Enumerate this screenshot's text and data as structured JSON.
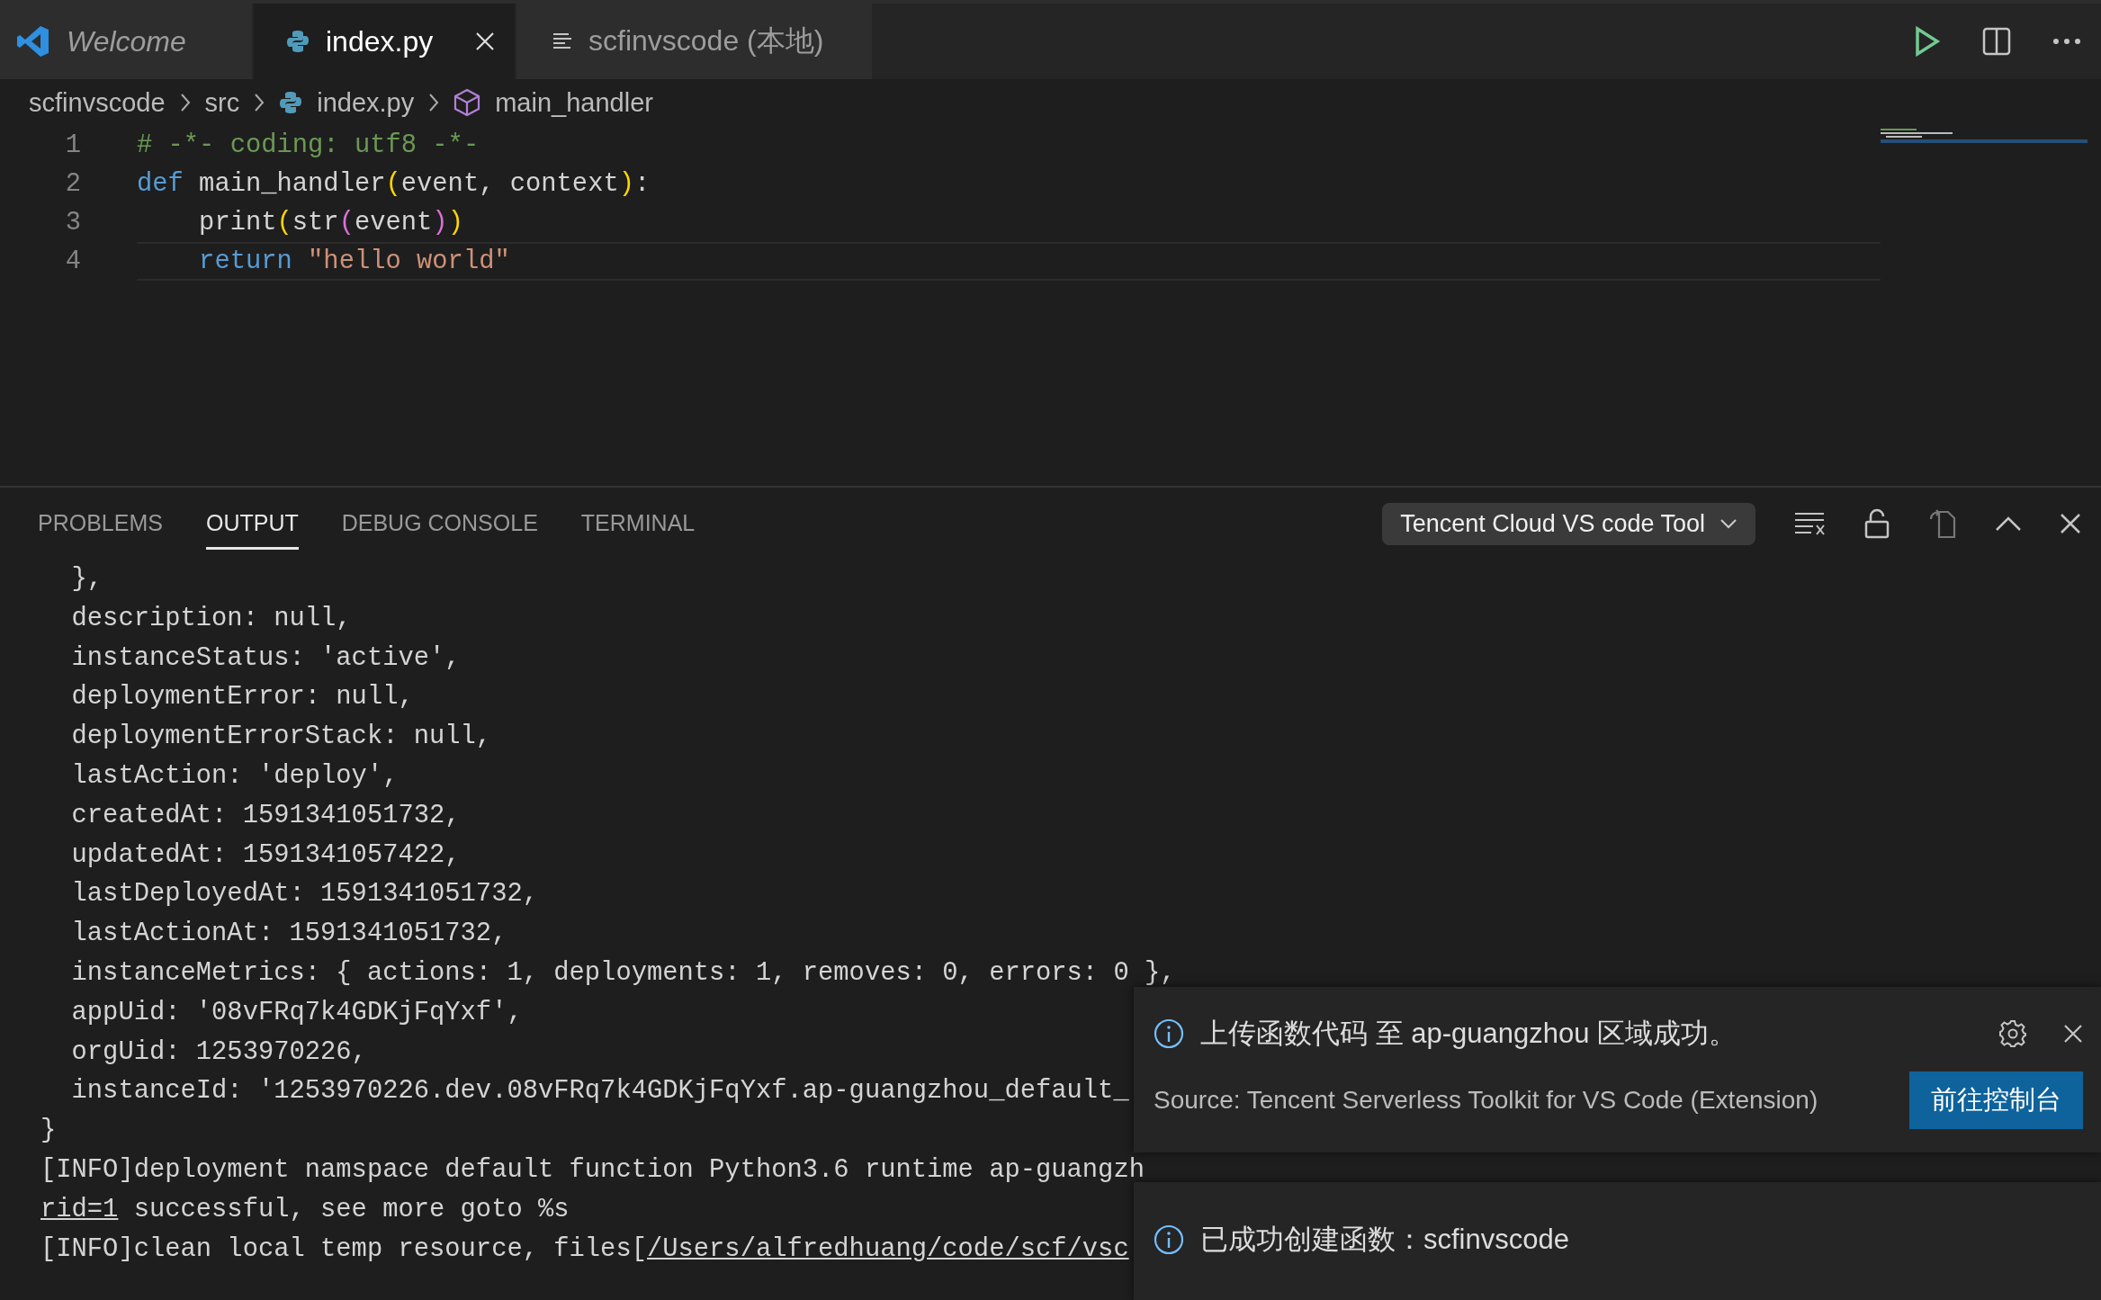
{
  "tabs": [
    {
      "label": "Welcome",
      "kind": "welcome",
      "preview": true,
      "selected": false
    },
    {
      "label": "index.py",
      "kind": "python",
      "preview": false,
      "selected": true
    },
    {
      "label": "scfinvscode (本地)",
      "kind": "preview",
      "preview": false,
      "selected": false
    }
  ],
  "breadcrumbs": [
    {
      "label": "scfinvscode",
      "kind": "folder"
    },
    {
      "label": "src",
      "kind": "folder"
    },
    {
      "label": "index.py",
      "kind": "python"
    },
    {
      "label": "main_handler",
      "kind": "symbol"
    }
  ],
  "code": [
    {
      "number": "1",
      "current": false,
      "tokens": [
        {
          "kind": "comment",
          "s": "# -*- coding: utf8 -*-"
        }
      ]
    },
    {
      "number": "2",
      "current": false,
      "tokens": [
        {
          "kind": "keyword",
          "s": "def"
        },
        {
          "kind": "plain",
          "s": " main_handler"
        },
        {
          "kind": "bracket1",
          "s": "("
        },
        {
          "kind": "plain",
          "s": "event, context"
        },
        {
          "kind": "bracket1",
          "s": ")"
        },
        {
          "kind": "plain",
          "s": ":"
        }
      ]
    },
    {
      "number": "3",
      "current": false,
      "tokens": [
        {
          "kind": "plain",
          "s": "    print"
        },
        {
          "kind": "bracket1",
          "s": "("
        },
        {
          "kind": "plain",
          "s": "str"
        },
        {
          "kind": "bracket2",
          "s": "("
        },
        {
          "kind": "plain",
          "s": "event"
        },
        {
          "kind": "bracket2",
          "s": ")"
        },
        {
          "kind": "bracket1",
          "s": ")"
        }
      ]
    },
    {
      "number": "4",
      "current": true,
      "tokens": [
        {
          "kind": "keyword",
          "s": "    return"
        },
        {
          "kind": "string",
          "s": " \"hello world\""
        }
      ]
    }
  ],
  "panel": {
    "tabs": [
      {
        "label": "PROBLEMS",
        "selected": false
      },
      {
        "label": "OUTPUT",
        "selected": true
      },
      {
        "label": "DEBUG CONSOLE",
        "selected": false
      },
      {
        "label": "TERMINAL",
        "selected": false
      }
    ],
    "channel": "Tencent Cloud VS code Tool",
    "output": [
      {
        "parts": [
          {
            "s": "  },"
          }
        ]
      },
      {
        "parts": [
          {
            "s": "  description: null,"
          }
        ]
      },
      {
        "parts": [
          {
            "s": "  instanceStatus: 'active',"
          }
        ]
      },
      {
        "parts": [
          {
            "s": "  deploymentError: null,"
          }
        ]
      },
      {
        "parts": [
          {
            "s": "  deploymentErrorStack: null,"
          }
        ]
      },
      {
        "parts": [
          {
            "s": "  lastAction: 'deploy',"
          }
        ]
      },
      {
        "parts": [
          {
            "s": "  createdAt: 1591341051732,"
          }
        ]
      },
      {
        "parts": [
          {
            "s": "  updatedAt: 1591341057422,"
          }
        ]
      },
      {
        "parts": [
          {
            "s": "  lastDeployedAt: 1591341051732,"
          }
        ]
      },
      {
        "parts": [
          {
            "s": "  lastActionAt: 1591341051732,"
          }
        ]
      },
      {
        "parts": [
          {
            "s": "  instanceMetrics: { actions: 1, deployments: 1, removes: 0, errors: 0 },"
          }
        ]
      },
      {
        "parts": [
          {
            "s": "  appUid: '08vFRq7k4GDKjFqYxf',"
          }
        ]
      },
      {
        "parts": [
          {
            "s": "  orgUid: 1253970226,"
          }
        ]
      },
      {
        "parts": [
          {
            "s": "  instanceId: '1253970226.dev.08vFRq7k4GDKjFqYxf.ap-guangzhou_default_"
          }
        ]
      },
      {
        "parts": [
          {
            "s": "}"
          }
        ]
      },
      {
        "parts": [
          {
            "s": "[INFO]deployment namspace default function Python3.6 runtime ap-guangzh"
          }
        ]
      },
      {
        "parts": [
          {
            "s": "rid=1",
            "link": true
          },
          {
            "s": " successful, see more goto %s"
          }
        ]
      },
      {
        "parts": [
          {
            "s": "[INFO]clean local temp resource, files["
          },
          {
            "s": "/Users/alfredhuang/code/scf/vsc",
            "link": true
          }
        ]
      }
    ]
  },
  "notifications": [
    {
      "message": "上传函数代码 至 ap-guangzhou 区域成功。",
      "source": "Source: Tencent Serverless Toolkit for VS Code (Extension)",
      "button": "前往控制台"
    },
    {
      "message": "已成功创建函数：scfinvscode"
    }
  ]
}
